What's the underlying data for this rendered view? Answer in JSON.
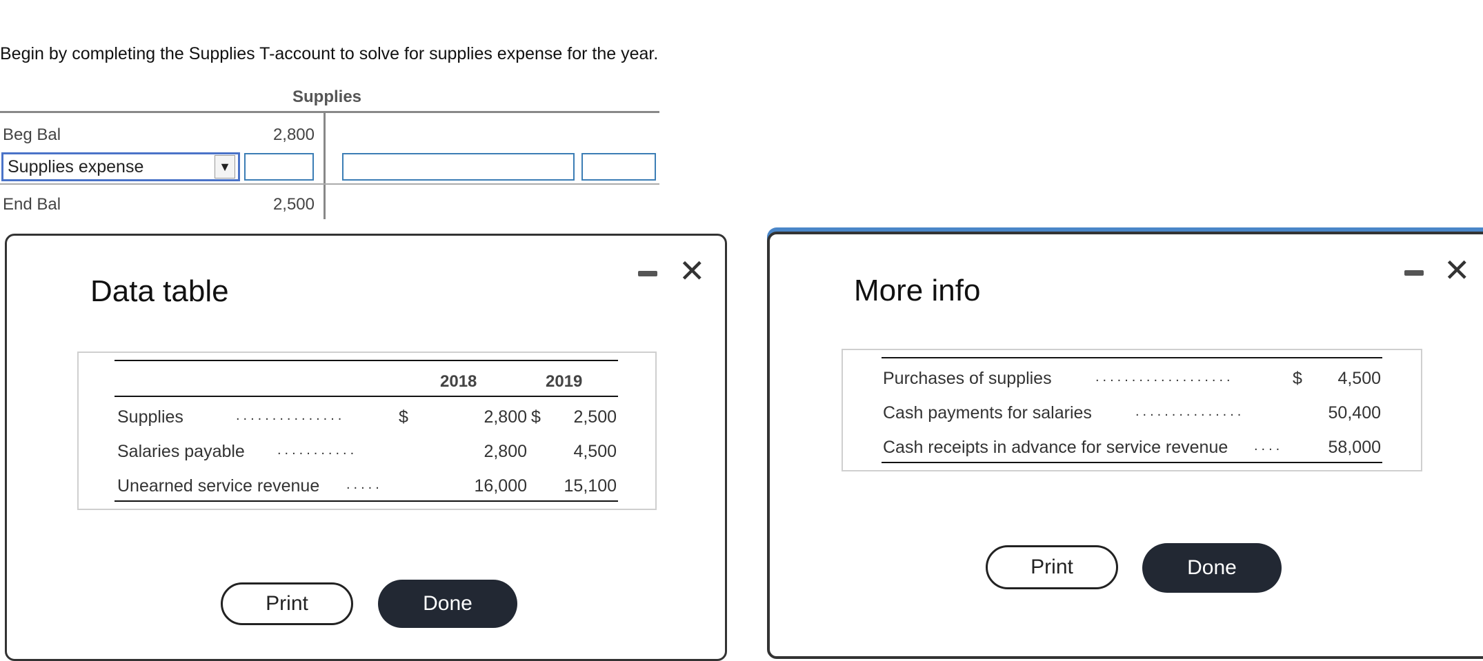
{
  "instruction": "Begin by completing the Supplies T-account to solve for supplies expense for the year.",
  "t_account": {
    "title": "Supplies",
    "beg_label": "Beg Bal",
    "beg_value": "2,800",
    "select_value": "Supplies expense",
    "select_arrow": "▼",
    "end_label": "End Bal",
    "end_value": "2,500"
  },
  "data_table": {
    "title": "Data table",
    "minimize_icon": "minimize-icon",
    "close_icon": "close-icon",
    "close_glyph": "✕",
    "headers": [
      "2018",
      "2019"
    ],
    "rows": [
      {
        "label": "Supplies",
        "dots": "...............",
        "cur1": "$",
        "v2018": "2,800",
        "cur2": "$",
        "v2019": "2,500"
      },
      {
        "label": "Salaries payable",
        "dots": "...........",
        "cur1": "",
        "v2018": "2,800",
        "cur2": "",
        "v2019": "4,500"
      },
      {
        "label": "Unearned service revenue",
        "dots": ".....",
        "cur1": "",
        "v2018": "16,000",
        "cur2": "",
        "v2019": "15,100"
      }
    ],
    "print_label": "Print",
    "done_label": "Done"
  },
  "more_info": {
    "title": "More info",
    "close_glyph": "✕",
    "rows": [
      {
        "label": "Purchases of supplies",
        "dots": "...................",
        "cur": "$",
        "value": "4,500"
      },
      {
        "label": "Cash payments for salaries",
        "dots": "...............",
        "cur": "",
        "value": "50,400"
      },
      {
        "label": "Cash receipts in advance for service revenue",
        "dots": "....",
        "cur": "",
        "value": "58,000"
      }
    ],
    "print_label": "Print",
    "done_label": "Done"
  },
  "colors": {
    "input_border": "#3b7db5",
    "select_border": "#4a73c8",
    "done_button": "#222833",
    "modal_focus": "#4a86c8"
  }
}
